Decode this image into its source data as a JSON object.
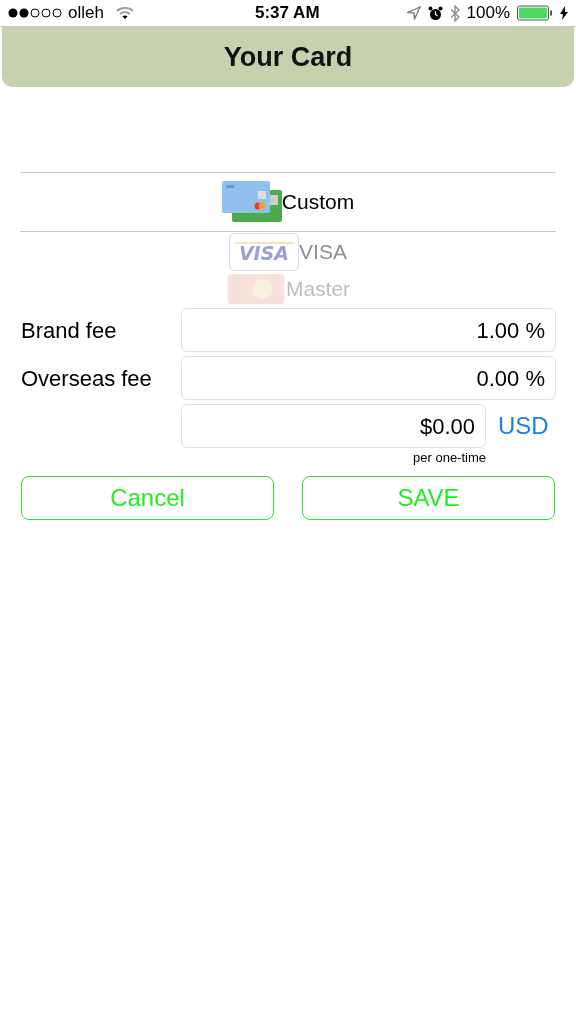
{
  "status_bar": {
    "carrier": "olleh",
    "time": "5:37 AM",
    "battery": "100%"
  },
  "header": {
    "title": "Your Card"
  },
  "card_picker": [
    {
      "label": "Custom",
      "kind": "custom",
      "selected": true
    },
    {
      "label": "VISA",
      "kind": "visa",
      "logo_text": "VISA",
      "selected": false
    },
    {
      "label": "Master",
      "kind": "master",
      "selected": false
    }
  ],
  "fields": [
    {
      "label": "Brand fee",
      "value": "1.00 %"
    },
    {
      "label": "Overseas fee",
      "value": "0.00 %"
    },
    {
      "value": "$0.00",
      "unit": "USD",
      "note": "per one-time"
    }
  ],
  "buttons": [
    "Cancel",
    "SAVE"
  ]
}
